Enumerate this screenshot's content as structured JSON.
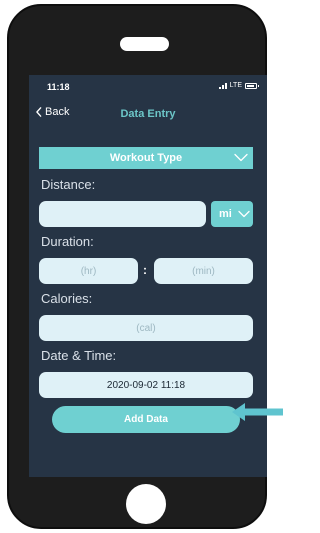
{
  "status_bar": {
    "time": "11:18",
    "network": "LTE"
  },
  "nav": {
    "back_label": "Back",
    "title": "Data Entry"
  },
  "form": {
    "workout_type_label": "Workout Type",
    "distance_label": "Distance:",
    "distance_value": "",
    "distance_unit": "mi",
    "duration_label": "Duration:",
    "hours_placeholder": "(hr)",
    "time_separator": ":",
    "minutes_placeholder": "(min)",
    "calories_label": "Calories:",
    "calories_placeholder": "(cal)",
    "datetime_label": "Date & Time:",
    "datetime_value": "2020-09-02 11:18",
    "submit_label": "Add Data"
  },
  "colors": {
    "screen_bg": "#263445",
    "accent": "#6fd0d1",
    "input_bg": "#dff1f7",
    "phone_body": "#1d1d1d",
    "annotation_arrow": "#5fc4cf"
  }
}
